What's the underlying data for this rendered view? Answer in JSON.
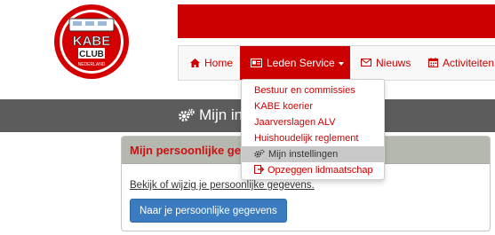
{
  "logo": {
    "top_text": "KABE",
    "bottom_text": "CLUB",
    "ring_text": "NEDERLAND"
  },
  "nav": {
    "items": [
      {
        "label": "Home",
        "icon": "home-icon"
      },
      {
        "label": "Leden Service",
        "icon": "id-card-icon",
        "active": true
      },
      {
        "label": "Nieuws",
        "icon": "envelope-icon"
      },
      {
        "label": "Activiteiten",
        "icon": "calendar-icon"
      }
    ]
  },
  "dropdown": {
    "items": [
      {
        "label": "Bestuur en commissies"
      },
      {
        "label": "KABE koerier"
      },
      {
        "label": "Jaarverslagen ALV"
      },
      {
        "label": "Huishoudelijk reglement"
      },
      {
        "label": "Mijn instellingen",
        "icon": "gears-icon",
        "highlighted": true
      },
      {
        "label": "Opzeggen lidmaatschap",
        "icon": "sign-out-icon"
      }
    ]
  },
  "page_header": {
    "title": "Mijn in",
    "icon": "gears-icon"
  },
  "panel": {
    "title": "Mijn persoonlijke ge",
    "link_text": "Bekijk of wijzig je persoonlijke gegevens.",
    "button_label": "Naar je persoonlijke gegevens"
  },
  "colors": {
    "brand_red": "#cc0000",
    "dark_strip": "#5c5c5c",
    "panel_header": "#b5b8ae",
    "button_blue": "#3a7cbf"
  }
}
